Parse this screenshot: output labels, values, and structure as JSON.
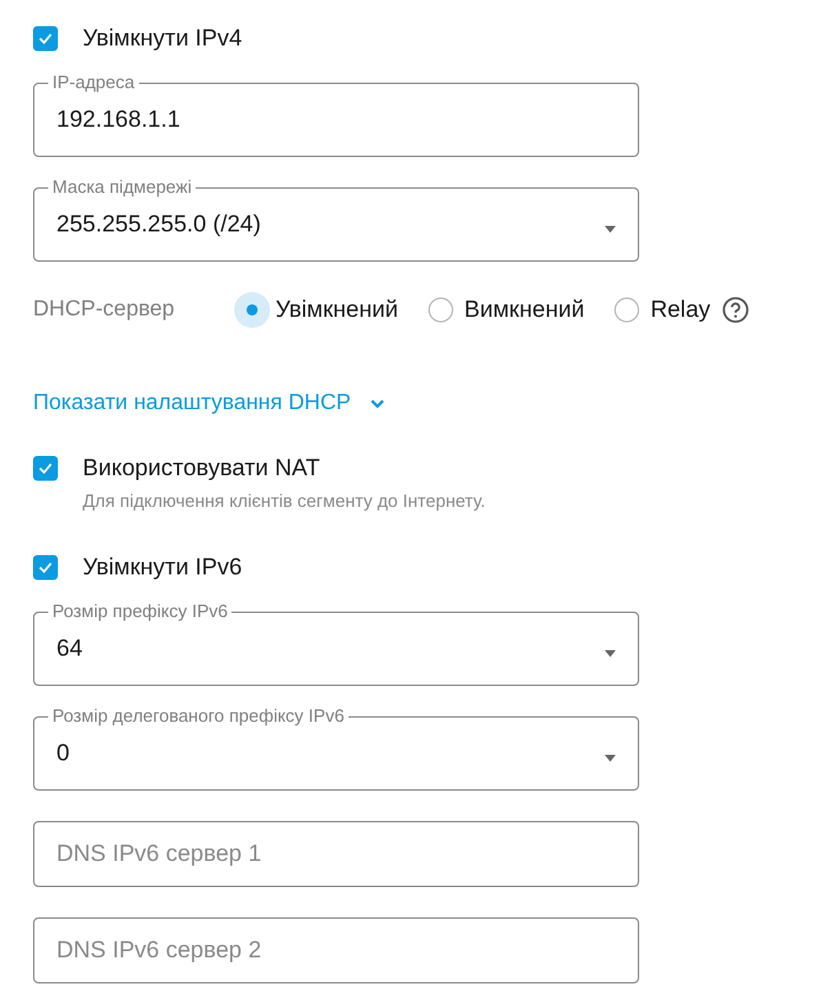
{
  "items": [
    {
      "kind": "checkbox",
      "label": "Увімкнути IPv4",
      "checked": true
    },
    {
      "kind": "field",
      "label": "IP-адреса",
      "value": "192.168.1.1",
      "dropdown": false
    },
    {
      "kind": "field",
      "label": "Маска підмережі",
      "value": "255.255.255.0 (/24)",
      "dropdown": true
    },
    {
      "kind": "radio",
      "label": "DHCP-сервер",
      "help": true,
      "options": [
        {
          "label": "Увімкнений",
          "selected": true
        },
        {
          "label": "Вимкнений",
          "selected": false
        },
        {
          "label": "Relay",
          "selected": false
        }
      ]
    },
    {
      "kind": "link",
      "label": "Показати налаштування DHCP",
      "expanded": false
    },
    {
      "kind": "checkbox",
      "label": "Використовувати NAT",
      "checked": true,
      "hint": "Для підключення клієнтів сегменту до Інтернету."
    },
    {
      "kind": "checkbox",
      "label": "Увімкнути IPv6",
      "checked": true
    },
    {
      "kind": "field",
      "label": "Розмір префіксу IPv6",
      "value": "64",
      "dropdown": true
    },
    {
      "kind": "field",
      "label": "Розмір делегованого префіксу IPv6",
      "value": "0",
      "dropdown": true
    },
    {
      "kind": "field",
      "placeholder": "DNS IPv6 сервер 1",
      "dropdown": false
    },
    {
      "kind": "field",
      "placeholder": "DNS IPv6 сервер 2",
      "dropdown": false
    }
  ]
}
